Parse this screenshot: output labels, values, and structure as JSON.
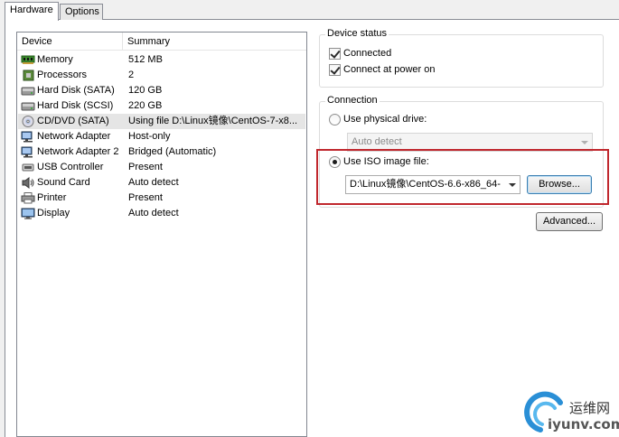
{
  "tabs": [
    {
      "label": "Hardware",
      "active": true
    },
    {
      "label": "Options",
      "active": false
    }
  ],
  "hardware": {
    "columns": {
      "device": "Device",
      "summary": "Summary"
    },
    "rows": [
      {
        "device": "Memory",
        "summary": "512 MB",
        "icon": "memory-icon"
      },
      {
        "device": "Processors",
        "summary": "2",
        "icon": "processor-icon"
      },
      {
        "device": "Hard Disk (SATA)",
        "summary": "120 GB",
        "icon": "hard-disk-icon"
      },
      {
        "device": "Hard Disk (SCSI)",
        "summary": "220 GB",
        "icon": "hard-disk-icon"
      },
      {
        "device": "CD/DVD (SATA)",
        "summary": "Using file D:\\Linux镜像\\CentOS-7-x8...",
        "icon": "cd-dvd-icon",
        "selected": true
      },
      {
        "device": "Network Adapter",
        "summary": "Host-only",
        "icon": "network-adapter-icon"
      },
      {
        "device": "Network Adapter 2",
        "summary": "Bridged (Automatic)",
        "icon": "network-adapter-icon"
      },
      {
        "device": "USB Controller",
        "summary": "Present",
        "icon": "usb-icon"
      },
      {
        "device": "Sound Card",
        "summary": "Auto detect",
        "icon": "sound-card-icon"
      },
      {
        "device": "Printer",
        "summary": "Present",
        "icon": "printer-icon"
      },
      {
        "device": "Display",
        "summary": "Auto detect",
        "icon": "display-icon"
      }
    ]
  },
  "device_status": {
    "title": "Device status",
    "connected_label": "Connected",
    "connected_checked": true,
    "connect_power_label": "Connect at power on",
    "connect_power_checked": true
  },
  "connection": {
    "title": "Connection",
    "physical_label": "Use physical drive:",
    "physical_value": "Auto detect",
    "iso_label": "Use ISO image file:",
    "iso_selected": true,
    "iso_value": "D:\\Linux镜像\\CentOS-6.6-x86_64-",
    "browse_label": "Browse..."
  },
  "advanced_label": "Advanced...",
  "watermark": {
    "line1": "运维网",
    "line2": "iyunv.com"
  },
  "colors": {
    "highlight": "#c0272d",
    "selection": "#e5e5e5"
  }
}
